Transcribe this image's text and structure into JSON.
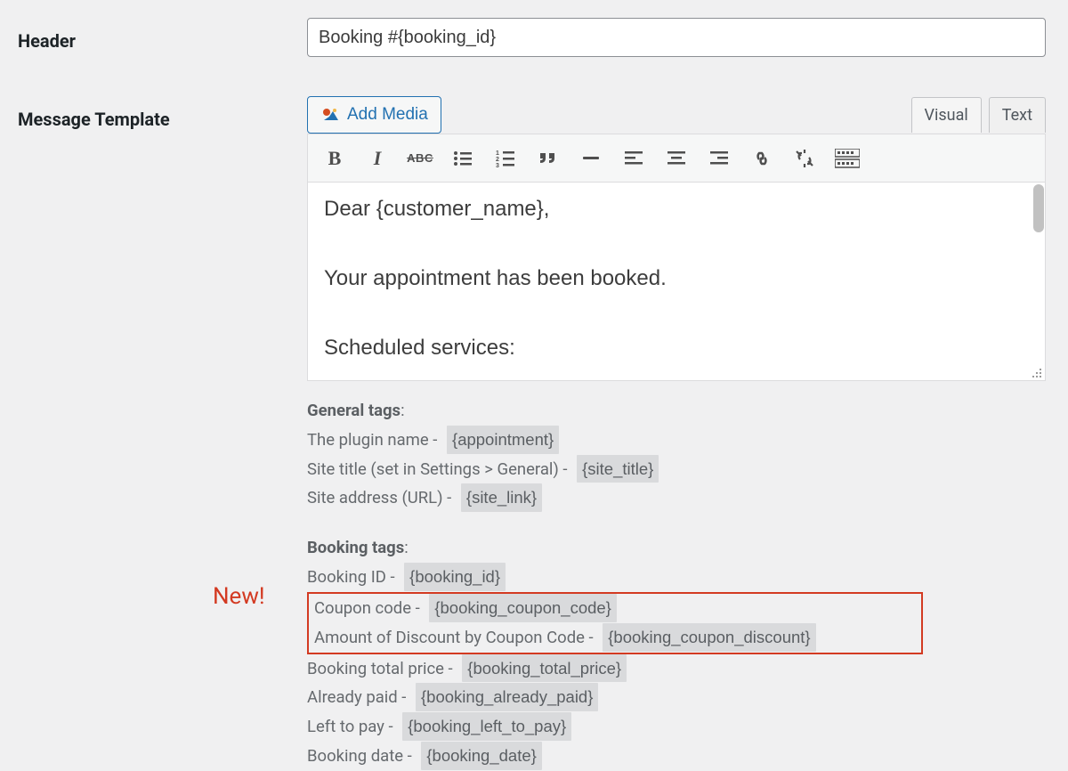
{
  "labels": {
    "header": "Header",
    "message_template": "Message Template"
  },
  "header_value": "Booking #{booking_id}",
  "add_media_label": "Add Media",
  "tabs": {
    "visual": "Visual",
    "text": "Text"
  },
  "toolbar_icons": {
    "bold": "B",
    "italic": "I",
    "strike": "ABC",
    "ul": "bullet-list",
    "ol": "numbered-list",
    "quote": "blockquote",
    "hr": "horizontal-rule",
    "align_left": "align-left",
    "align_center": "align-center",
    "align_right": "align-right",
    "link": "link",
    "unlink": "unlink",
    "keyboard": "toolbar-toggle"
  },
  "editor_lines": {
    "l1": "Dear {customer_name},",
    "l2": "Your appointment has been booked.",
    "l3": "Scheduled services:"
  },
  "tags": {
    "general_heading": "General tags",
    "booking_heading": "Booking tags",
    "new_badge": "New!",
    "general": {
      "plugin_name_label": "The plugin name - ",
      "plugin_name_token": "{appointment}",
      "site_title_label": "Site title (set in Settings > General) - ",
      "site_title_token": "{site_title}",
      "site_address_label": "Site address (URL) - ",
      "site_address_token": "{site_link}"
    },
    "booking": {
      "id_label": "Booking ID - ",
      "id_token": "{booking_id}",
      "coupon_label": "Coupon code - ",
      "coupon_token": "{booking_coupon_code}",
      "discount_label": "Amount of Discount by Coupon Code - ",
      "discount_token": "{booking_coupon_discount}",
      "total_label": "Booking total price - ",
      "total_token": "{booking_total_price}",
      "paid_label": "Already paid - ",
      "paid_token": "{booking_already_paid}",
      "left_label": "Left to pay - ",
      "left_token": "{booking_left_to_pay}",
      "date_label": "Booking date - ",
      "date_token": "{booking_date}"
    }
  }
}
